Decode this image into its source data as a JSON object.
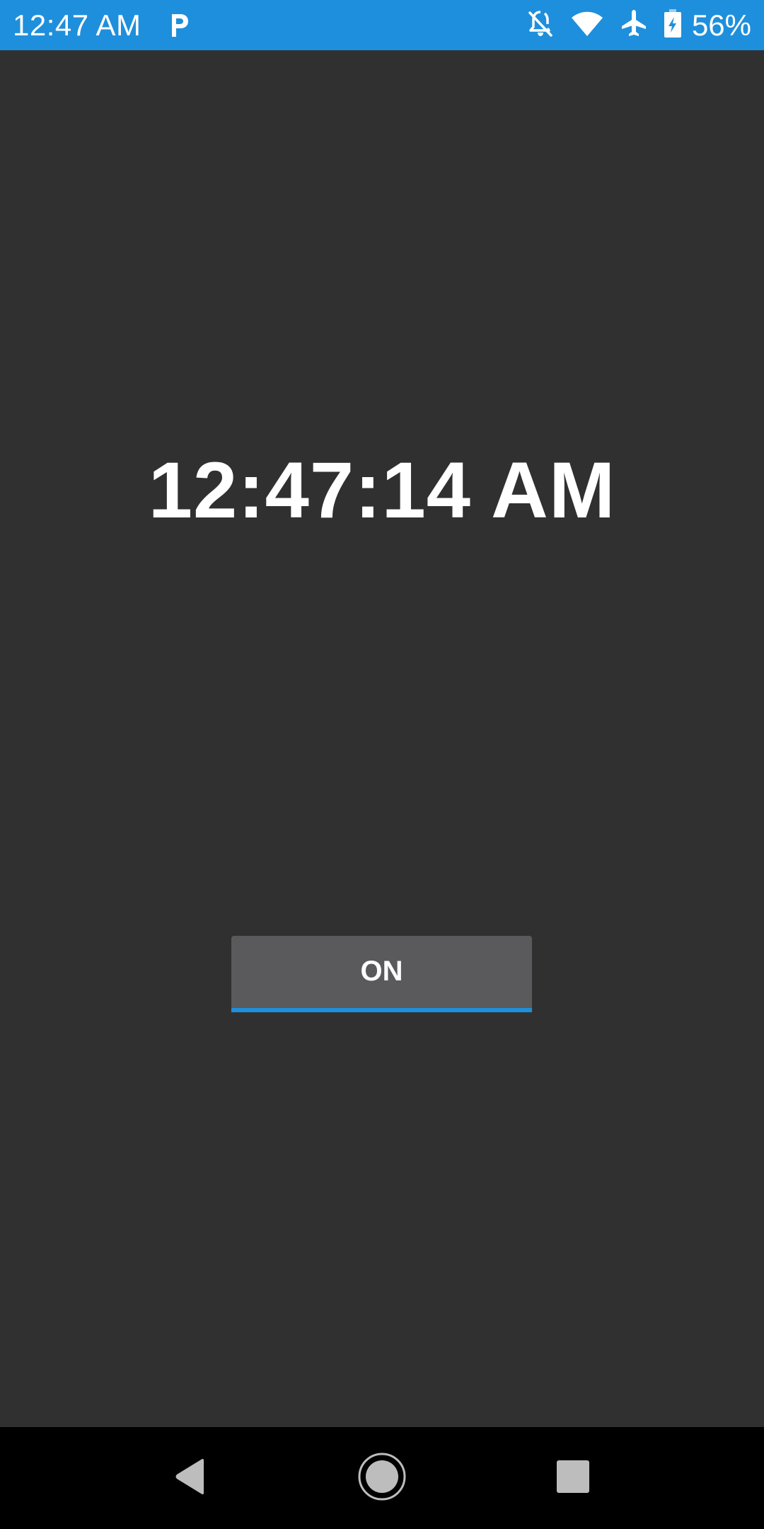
{
  "status_bar": {
    "time": "12:47 AM",
    "battery_percent": "56%",
    "background_color": "#1e8fdc",
    "icons": [
      "parking-notification-icon",
      "notifications-off-icon",
      "wifi-icon",
      "airplane-mode-icon",
      "battery-charging-icon"
    ]
  },
  "main": {
    "clock_text": "12:47:14 AM",
    "toggle_button_label": "ON",
    "accent_color": "#1e8fdc",
    "background_color": "#303030"
  },
  "nav_bar": {
    "buttons": [
      "back-icon",
      "home-icon",
      "recents-icon"
    ]
  }
}
